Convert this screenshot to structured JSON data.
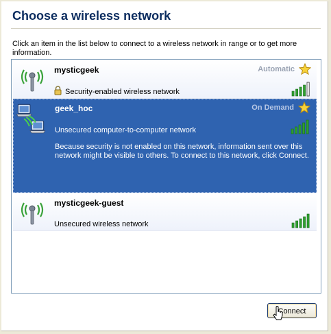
{
  "dialog": {
    "title": "Choose a wireless network",
    "intro": "Click an item in the list below to connect to a wireless network in range or to get more information."
  },
  "networks": [
    {
      "name": "mysticgeek",
      "connection_mode": "Automatic",
      "security": "Security-enabled wireless network",
      "signal_strength": 4,
      "icon": "wireless-antenna-icon",
      "secured": true,
      "selected": false
    },
    {
      "name": "geek_hoc",
      "connection_mode": "On Demand",
      "security": "Unsecured computer-to-computer network",
      "description": "Because security is not enabled on this network, information sent over this network might be visible to others. To connect to this network, click Connect.",
      "signal_strength": 5,
      "icon": "computer-to-computer-icon",
      "secured": false,
      "selected": true
    },
    {
      "name": "mysticgeek-guest",
      "security": "Unsecured wireless network",
      "signal_strength": 5,
      "icon": "wireless-antenna-icon",
      "secured": false,
      "selected": false
    }
  ],
  "actions": {
    "connect_label": "Connect"
  },
  "colors": {
    "title": "#0b2c5f",
    "selection": "#2f63b0",
    "signal_bar": "#2ea02e",
    "signal_bar_empty": "#ffffff"
  }
}
